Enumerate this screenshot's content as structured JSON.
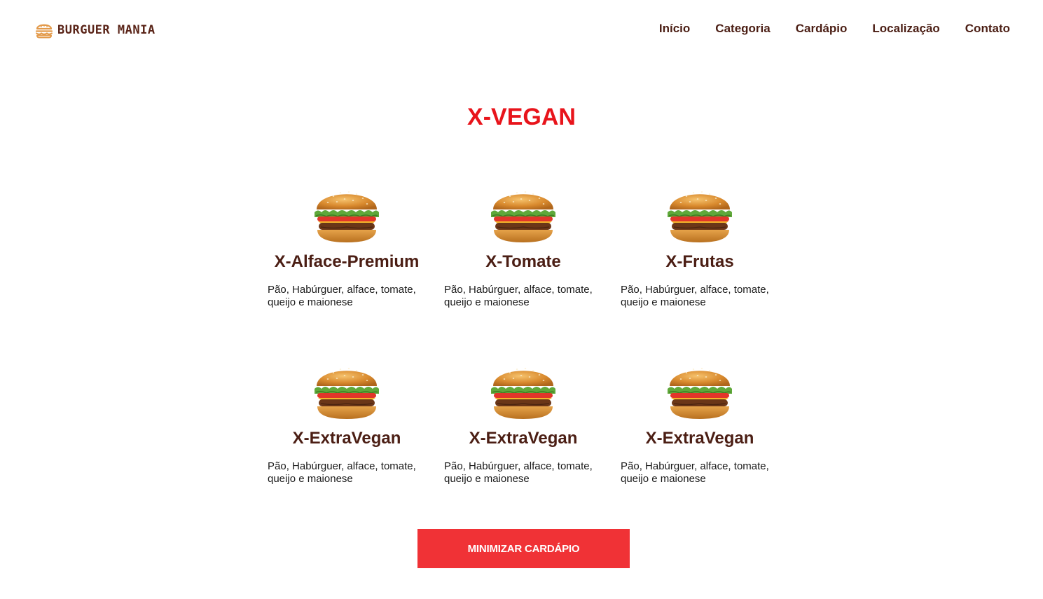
{
  "brand": {
    "name": "BURGUER MANIA",
    "icon": "burger-icon"
  },
  "nav": {
    "items": [
      {
        "label": "Início"
      },
      {
        "label": "Categoria"
      },
      {
        "label": "Cardápio"
      },
      {
        "label": "Localização"
      },
      {
        "label": "Contato"
      }
    ]
  },
  "menu": {
    "title": "X-VEGAN",
    "items": [
      {
        "name": "X-Alface-Premium",
        "description": "Pão, Habúrguer, alface, tomate, queijo e maionese",
        "image": "burger-image"
      },
      {
        "name": "X-Tomate",
        "description": "Pão, Habúrguer, alface, tomate, queijo e maionese",
        "image": "burger-image"
      },
      {
        "name": "X-Frutas",
        "description": "Pão, Habúrguer, alface, tomate, queijo e maionese",
        "image": "burger-image"
      },
      {
        "name": "X-ExtraVegan",
        "description": "Pão, Habúrguer, alface, tomate, queijo e maionese",
        "image": "burger-image"
      },
      {
        "name": "X-ExtraVegan",
        "description": "Pão, Habúrguer, alface, tomate, queijo e maionese",
        "image": "burger-image"
      },
      {
        "name": "X-ExtraVegan",
        "description": "Pão, Habúrguer, alface, tomate, queijo e maionese",
        "image": "burger-image"
      }
    ],
    "button_label": "MINIMIZAR CARDÁPIO"
  },
  "colors": {
    "accent": "#e8141b",
    "button": "#f03236",
    "brown": "#4b1e14",
    "logo_icon": "#e39a4a"
  }
}
